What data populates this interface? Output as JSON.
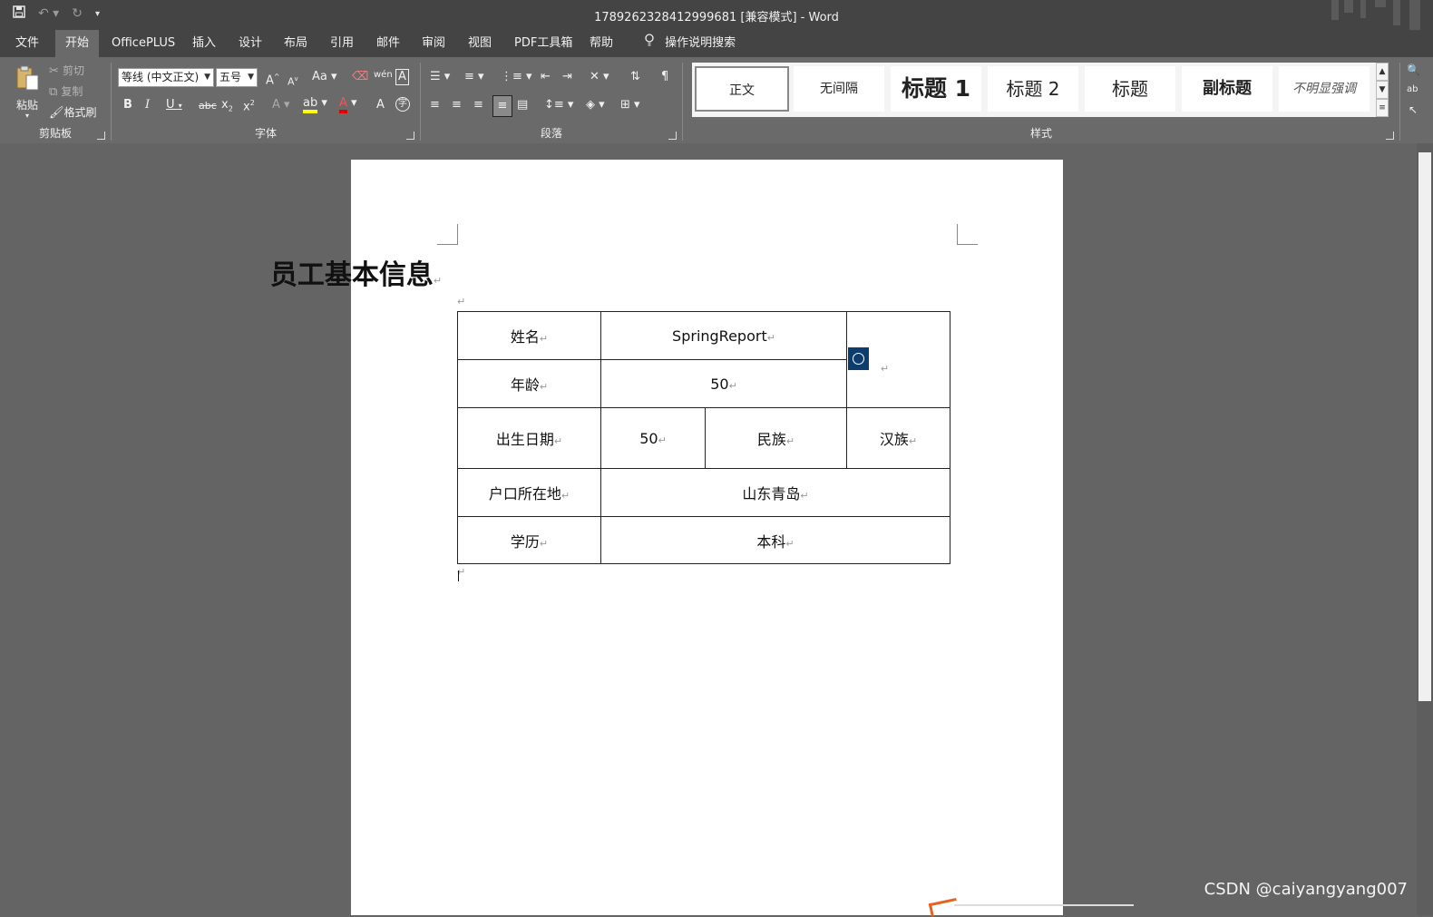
{
  "titlebar": {
    "doc_title": "1789262328412999681 [兼容模式]  -  Word",
    "qat_icons": [
      "save-icon",
      "undo-icon",
      "redo-icon",
      "customize-icon"
    ]
  },
  "tabs": [
    {
      "label": "文件"
    },
    {
      "label": "开始"
    },
    {
      "label": "OfficePLUS"
    },
    {
      "label": "插入"
    },
    {
      "label": "设计"
    },
    {
      "label": "布局"
    },
    {
      "label": "引用"
    },
    {
      "label": "邮件"
    },
    {
      "label": "审阅"
    },
    {
      "label": "视图"
    },
    {
      "label": "PDF工具箱"
    },
    {
      "label": "帮助"
    },
    {
      "label": "操作说明搜索"
    }
  ],
  "ribbon": {
    "clipboard": {
      "label": "剪贴板",
      "paste": "粘贴",
      "cut": "剪切",
      "copy": "复制",
      "format_painter": "格式刷"
    },
    "font": {
      "label": "字体",
      "font_name": "等线 (中文正文)",
      "font_size": "五号"
    },
    "paragraph": {
      "label": "段落"
    },
    "styles": {
      "label": "样式",
      "items": [
        "正文",
        "无间隔",
        "标题 1",
        "标题 2",
        "标题",
        "副标题",
        "不明显强调"
      ]
    }
  },
  "document": {
    "title": "员工基本信息",
    "paragraph_mark": "↵",
    "table": {
      "row1": {
        "label": "姓名",
        "value": "SpringReport"
      },
      "row2": {
        "label": "年龄",
        "value": "50"
      },
      "row3": {
        "label": "出生日期",
        "value": "50",
        "label2": "民族",
        "value2": "汉族"
      },
      "row4": {
        "label": "户口所在地",
        "value": "山东青岛"
      },
      "row5": {
        "label": "学历",
        "value": "本科"
      }
    }
  },
  "watermark": "CSDN @caiyangyang007"
}
